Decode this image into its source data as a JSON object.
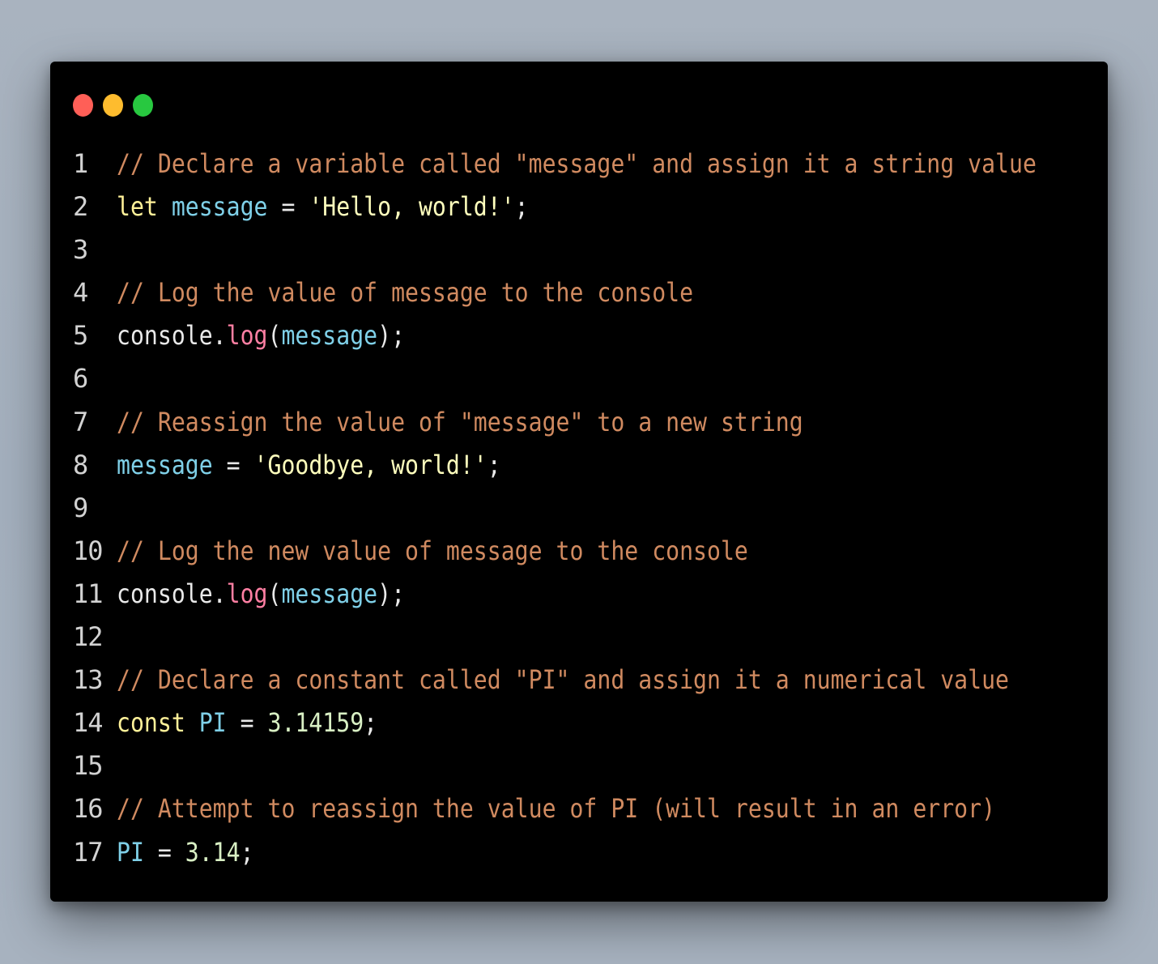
{
  "window": {
    "traffic_lights": [
      {
        "name": "close",
        "color": "#ff5f57"
      },
      {
        "name": "minimize",
        "color": "#febc2e"
      },
      {
        "name": "maximize",
        "color": "#28c840"
      }
    ]
  },
  "colors": {
    "comment": "#d08a60",
    "keyword": "#fff199",
    "variable": "#7fd0e8",
    "string": "#ffffbd",
    "function": "#ff7fa3",
    "number": "#d9f0c4",
    "plain": "#e9e9e9"
  },
  "code": {
    "lines": [
      {
        "number": "1",
        "tokens": [
          {
            "type": "comment",
            "text": "// Declare a variable called \"message\" and assign it a string value"
          }
        ]
      },
      {
        "number": "2",
        "tokens": [
          {
            "type": "kw",
            "text": "let"
          },
          {
            "type": "plain",
            "text": " "
          },
          {
            "type": "var",
            "text": "message"
          },
          {
            "type": "plain",
            "text": " = "
          },
          {
            "type": "str",
            "text": "'Hello, world!'"
          },
          {
            "type": "plain",
            "text": ";"
          }
        ]
      },
      {
        "number": "3",
        "tokens": []
      },
      {
        "number": "4",
        "tokens": [
          {
            "type": "comment",
            "text": "// Log the value of message to the console"
          }
        ]
      },
      {
        "number": "5",
        "tokens": [
          {
            "type": "plain",
            "text": "console."
          },
          {
            "type": "fn",
            "text": "log"
          },
          {
            "type": "plain",
            "text": "("
          },
          {
            "type": "var",
            "text": "message"
          },
          {
            "type": "plain",
            "text": ");"
          }
        ]
      },
      {
        "number": "6",
        "tokens": []
      },
      {
        "number": "7",
        "tokens": [
          {
            "type": "comment",
            "text": "// Reassign the value of \"message\" to a new string"
          }
        ]
      },
      {
        "number": "8",
        "tokens": [
          {
            "type": "var",
            "text": "message"
          },
          {
            "type": "plain",
            "text": " = "
          },
          {
            "type": "str",
            "text": "'Goodbye, world!'"
          },
          {
            "type": "plain",
            "text": ";"
          }
        ]
      },
      {
        "number": "9",
        "tokens": []
      },
      {
        "number": "10",
        "tokens": [
          {
            "type": "comment",
            "text": "// Log the new value of message to the console"
          }
        ]
      },
      {
        "number": "11",
        "tokens": [
          {
            "type": "plain",
            "text": "console."
          },
          {
            "type": "fn",
            "text": "log"
          },
          {
            "type": "plain",
            "text": "("
          },
          {
            "type": "var",
            "text": "message"
          },
          {
            "type": "plain",
            "text": ");"
          }
        ]
      },
      {
        "number": "12",
        "tokens": []
      },
      {
        "number": "13",
        "tokens": [
          {
            "type": "comment",
            "text": "// Declare a constant called \"PI\" and assign it a numerical value"
          }
        ]
      },
      {
        "number": "14",
        "tokens": [
          {
            "type": "kw",
            "text": "const"
          },
          {
            "type": "plain",
            "text": " "
          },
          {
            "type": "var",
            "text": "PI"
          },
          {
            "type": "plain",
            "text": " = "
          },
          {
            "type": "num",
            "text": "3.14159"
          },
          {
            "type": "plain",
            "text": ";"
          }
        ]
      },
      {
        "number": "15",
        "tokens": []
      },
      {
        "number": "16",
        "tokens": [
          {
            "type": "comment",
            "text": "// Attempt to reassign the value of PI (will result in an error)"
          }
        ]
      },
      {
        "number": "17",
        "tokens": [
          {
            "type": "var",
            "text": "PI"
          },
          {
            "type": "plain",
            "text": " = "
          },
          {
            "type": "num",
            "text": "3.14"
          },
          {
            "type": "plain",
            "text": ";"
          }
        ]
      }
    ]
  }
}
